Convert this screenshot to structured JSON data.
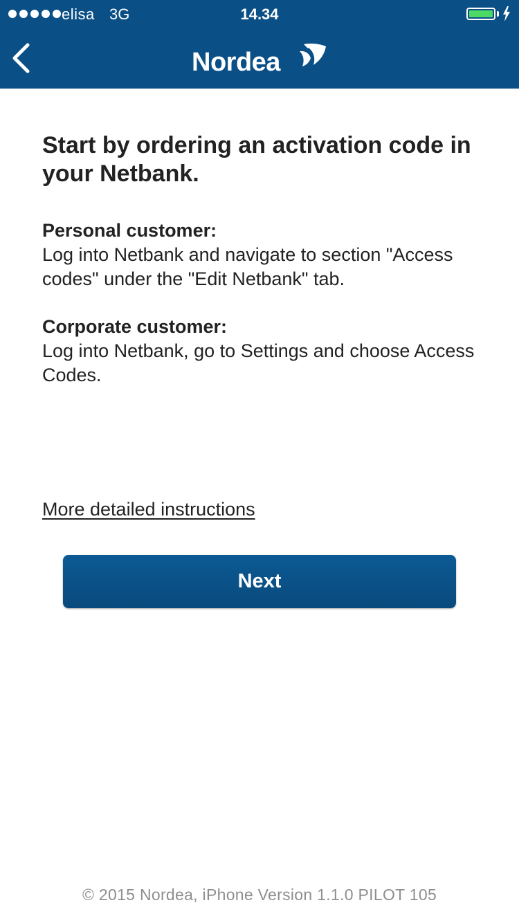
{
  "status_bar": {
    "carrier": "elisa",
    "network": "3G",
    "time": "14.34",
    "signal_bars": 5,
    "battery_level": 1.0,
    "battery_color": "#4cd964"
  },
  "header": {
    "back_icon": "chevron-left-icon",
    "logo_text": "Nordea",
    "logo_icon": "nordea-sail-logo",
    "background_color": "#0a4f86"
  },
  "main": {
    "heading": "Start by ordering an activation code in your Netbank.",
    "personal": {
      "title": "Personal customer:",
      "text": "Log into Netbank and navigate to section \"Access codes\" under the \"Edit Netbank\" tab."
    },
    "corporate": {
      "title": "Corporate customer:",
      "text": "Log into Netbank, go to Settings and choose Access Codes."
    },
    "instructions_link": "More detailed instructions",
    "next_button": "Next"
  },
  "footer": {
    "text": "© 2015 Nordea, iPhone Version 1.1.0 PILOT 105"
  }
}
